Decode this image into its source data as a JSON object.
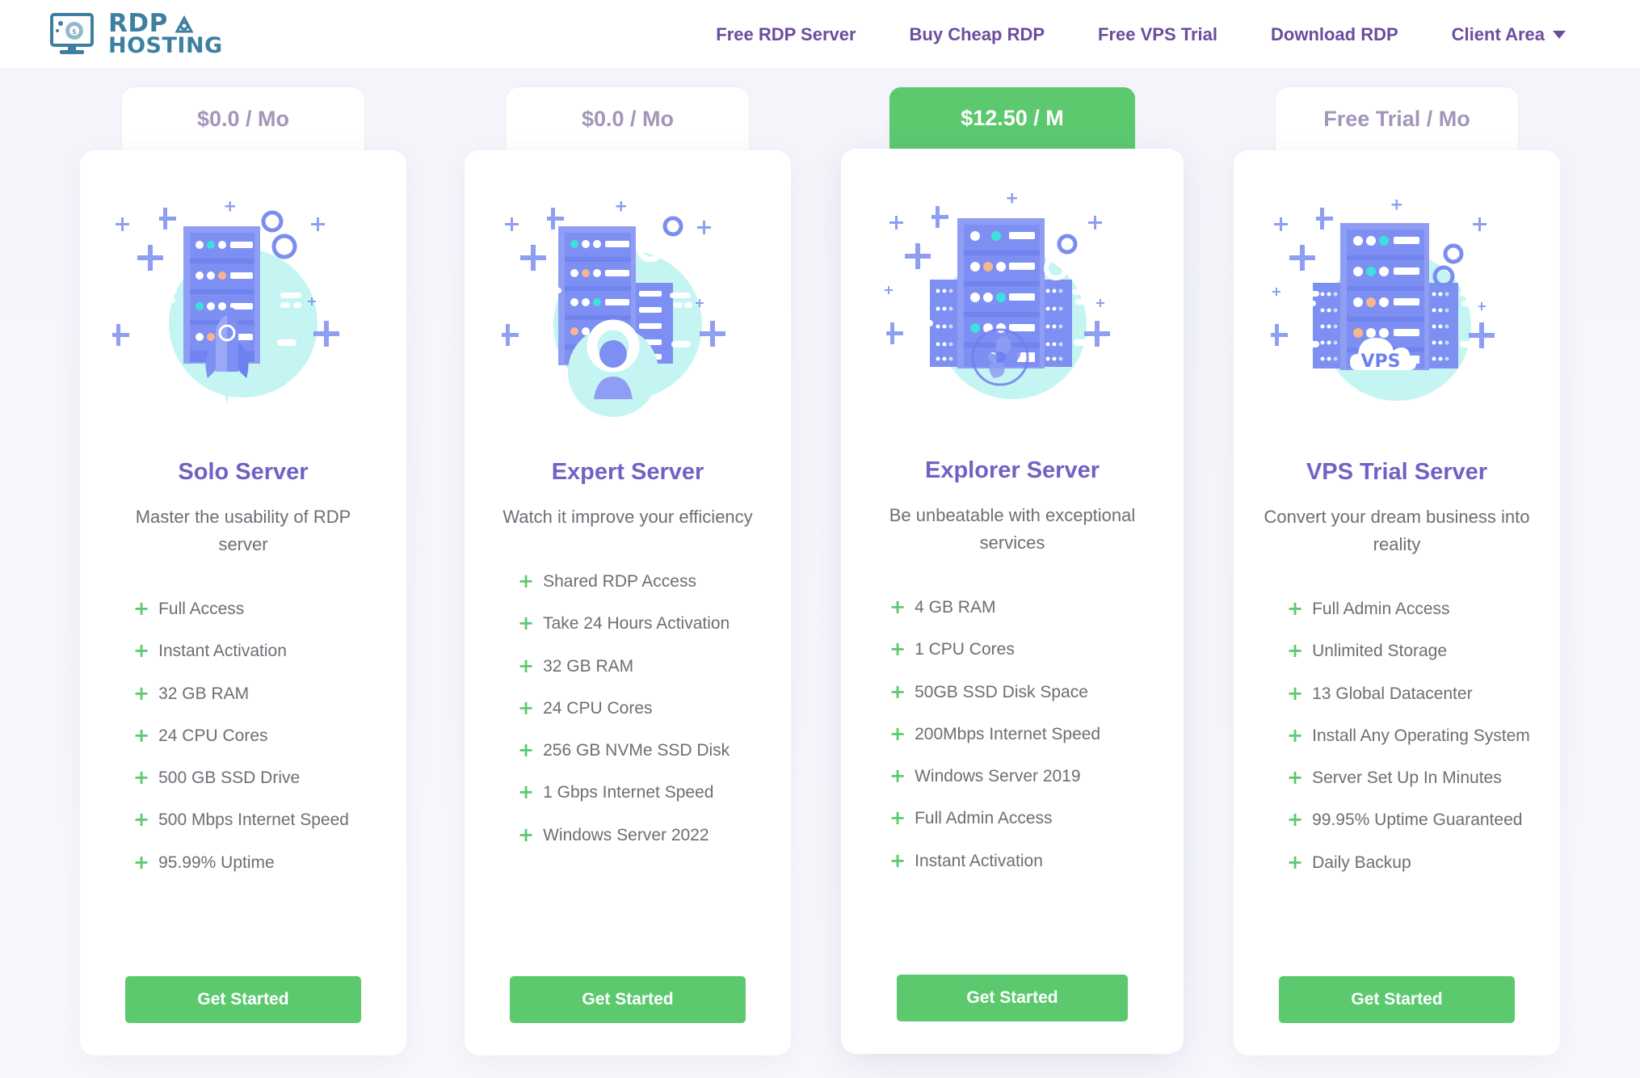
{
  "brand": {
    "name_line1": "RDP",
    "name_line2": "HOSTING",
    "color": "#3d7fa0"
  },
  "nav": {
    "items": [
      {
        "label": "Free RDP Server",
        "has_caret": false
      },
      {
        "label": "Buy Cheap RDP",
        "has_caret": false
      },
      {
        "label": "Free VPS Trial",
        "has_caret": false
      },
      {
        "label": "Download RDP",
        "has_caret": false
      },
      {
        "label": "Client Area",
        "has_caret": true
      }
    ],
    "color": "#6b4d9e"
  },
  "colors": {
    "accent_green": "#5cc96f",
    "title_purple": "#6e63c4",
    "badge_text": "#a296b9",
    "body_text": "#6d6d76",
    "page_bg": "#f6f7fb"
  },
  "plans": [
    {
      "price": "$0.0 / Mo",
      "featured": false,
      "illustration": "server-rack-rocket-illustration",
      "title": "Solo Server",
      "description": "Master the usability of RDP server",
      "features": [
        "Full Access",
        "Instant Activation",
        "32 GB RAM",
        "24 CPU Cores",
        "500 GB SSD Drive",
        "500 Mbps Internet Speed",
        "95.99% Uptime"
      ],
      "cta": "Get Started"
    },
    {
      "price": "$0.0 / Mo",
      "featured": false,
      "illustration": "server-rack-support-person-illustration",
      "title": "Expert Server",
      "description": "Watch it improve your efficiency",
      "features": [
        "Shared RDP Access",
        "Take 24 Hours Activation",
        "32 GB RAM",
        "24 CPU Cores",
        "256 GB NVMe SSD Disk",
        "1 Gbps Internet Speed",
        "Windows Server 2022"
      ],
      "cta": "Get Started"
    },
    {
      "price": "$12.50 / M",
      "featured": true,
      "illustration": "server-rack-fan-illustration",
      "title": "Explorer Server",
      "description": "Be unbeatable with exceptional services",
      "features": [
        "4 GB RAM",
        "1 CPU Cores",
        "50GB SSD Disk Space",
        "200Mbps Internet Speed",
        "Windows Server 2019",
        "Full Admin Access",
        "Instant Activation"
      ],
      "cta": "Get Started"
    },
    {
      "price": "Free Trial / Mo",
      "featured": false,
      "illustration": "server-rack-vps-cloud-illustration",
      "title": "VPS Trial Server",
      "description": "Convert your dream business into reality",
      "features": [
        "Full Admin Access",
        "Unlimited Storage",
        "13 Global Datacenter",
        "Install Any Operating System",
        "Server Set Up In Minutes",
        "99.95% Uptime Guaranteed",
        "Daily Backup"
      ],
      "cta": "Get Started"
    }
  ],
  "illustration_labels": {
    "vps_cloud": "VPS"
  }
}
